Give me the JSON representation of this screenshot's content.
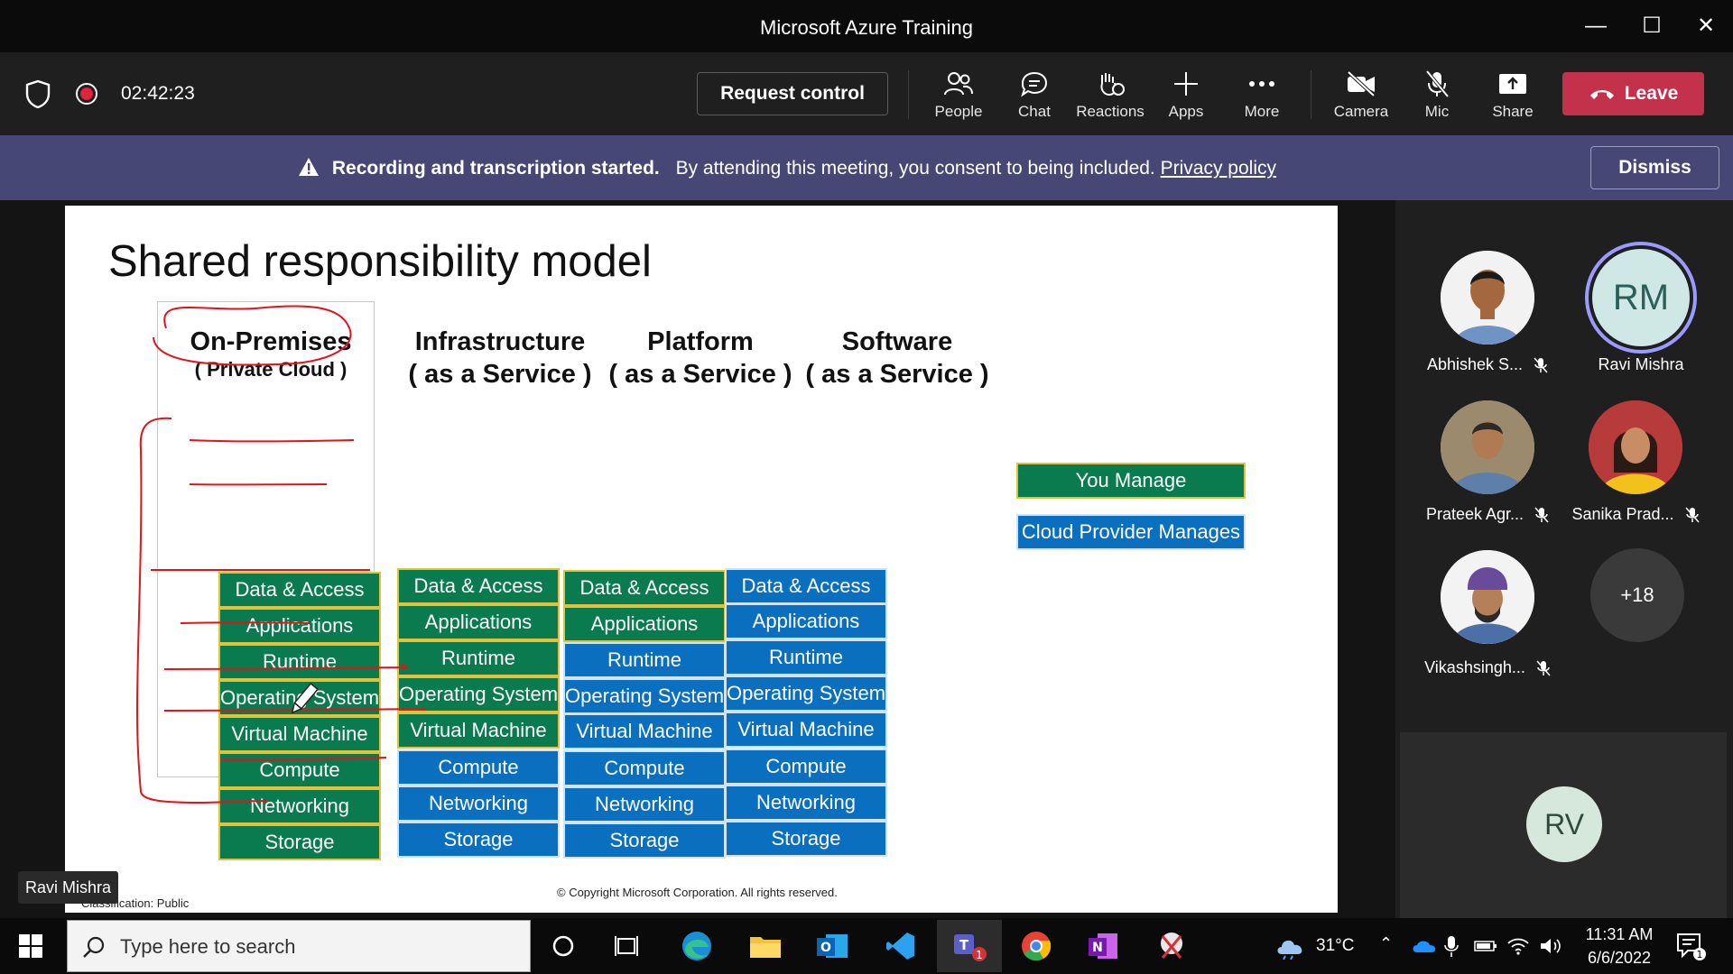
{
  "window": {
    "title": "Microsoft Azure Training"
  },
  "toolbar": {
    "timer": "02:42:23",
    "request_control": "Request control",
    "people": "People",
    "chat": "Chat",
    "reactions": "Reactions",
    "apps": "Apps",
    "more": "More",
    "camera": "Camera",
    "mic": "Mic",
    "share": "Share",
    "leave": "Leave"
  },
  "banner": {
    "bold": "Recording and transcription started.",
    "text": "By attending this meeting, you consent to being included.",
    "link": "Privacy policy",
    "dismiss": "Dismiss"
  },
  "slide": {
    "title": "Shared responsibility model",
    "columns": [
      {
        "line1": "On-Premises",
        "line2": "( Private Cloud )"
      },
      {
        "line1": "Infrastructure",
        "line2": "( as a Service )"
      },
      {
        "line1": "Platform",
        "line2": "( as a Service )"
      },
      {
        "line1": "Software",
        "line2": "( as a Service )"
      }
    ],
    "layers": [
      "Data & Access",
      "Applications",
      "Runtime",
      "Operating System",
      "Virtual Machine",
      "Compute",
      "Networking",
      "Storage"
    ],
    "legend": {
      "you_manage": "You Manage",
      "cloud_manages": "Cloud Provider Manages"
    },
    "copyright": "© Copyright Microsoft Corporation. All rights reserved.",
    "classification": "Classification: Public",
    "colors": {
      "you_manage": "#0a7a4f",
      "cloud_manages": "#0a6fbf",
      "annotation": "#e0141c"
    }
  },
  "presenter_tag": "Ravi Mishra",
  "participants": [
    {
      "name": "Abhishek S...",
      "muted": true
    },
    {
      "name": "Ravi Mishra",
      "initials": "RM",
      "muted": false
    },
    {
      "name": "Prateek Agr...",
      "muted": true
    },
    {
      "name": "Sanika Prad...",
      "muted": true
    },
    {
      "name": "Vikashsingh...",
      "muted": true
    },
    {
      "name": "",
      "overflow": "+18"
    }
  ],
  "self_tile": {
    "initials": "RV"
  },
  "taskbar": {
    "search_placeholder": "Type here to search",
    "weather": "31°C",
    "time": "11:31 AM",
    "date": "6/6/2022",
    "teams_badge": "1",
    "notif_badge": "1"
  }
}
